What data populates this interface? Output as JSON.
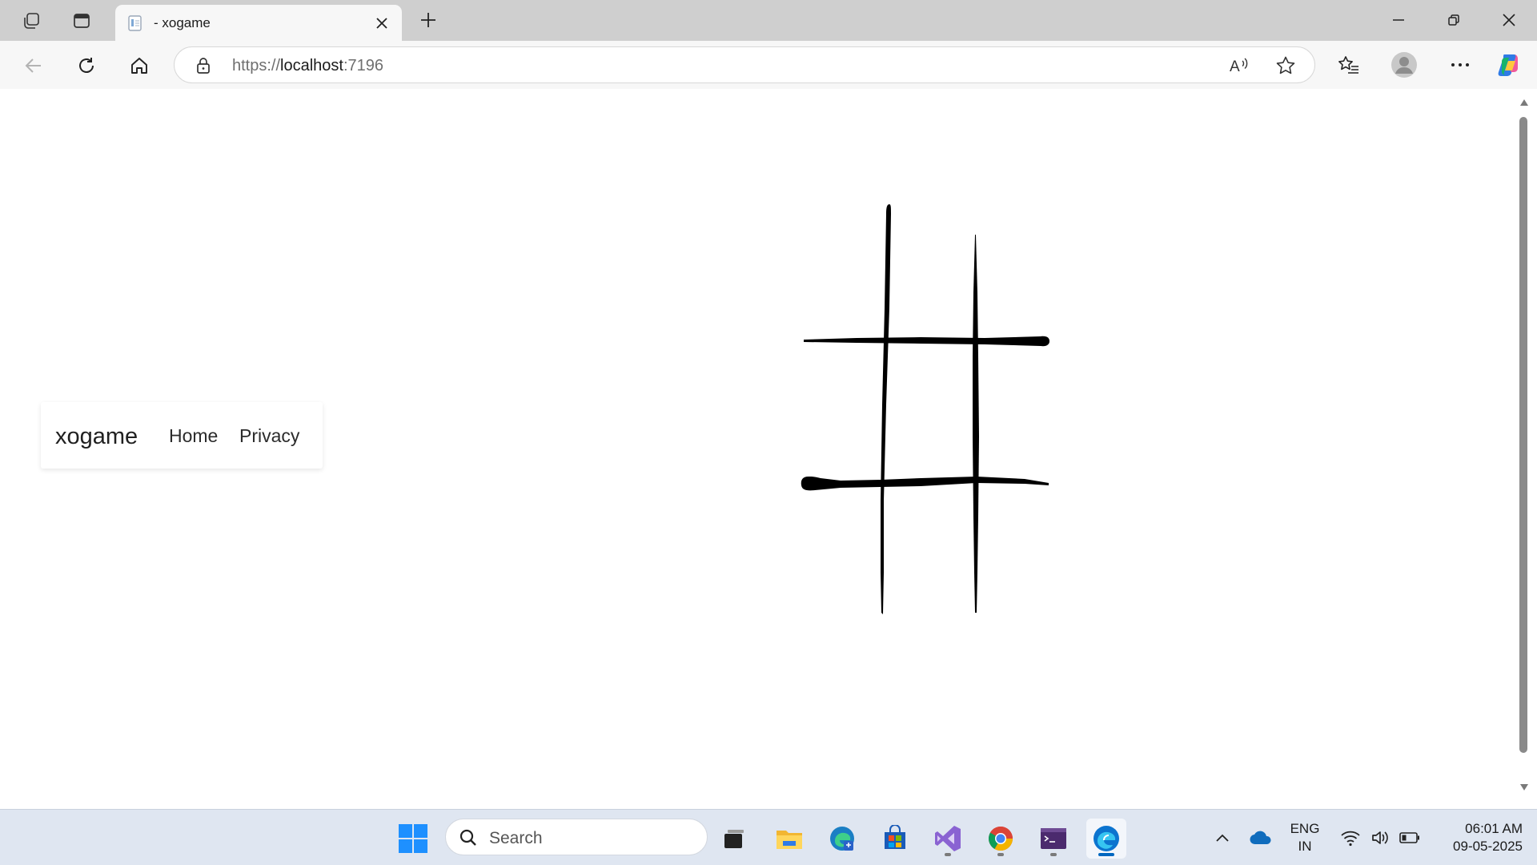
{
  "browser": {
    "tab": {
      "title": "- xogame",
      "close_glyph": "✕"
    },
    "new_tab_glyph": "+",
    "address": {
      "scheme": "https://",
      "host": "localhost",
      "port": ":7196"
    },
    "icons": [
      "workspaces-icon",
      "tab-actions-icon",
      "back-icon",
      "refresh-icon",
      "home-icon",
      "lock-icon",
      "read-aloud-icon",
      "favorite-star-icon",
      "favorites-icon",
      "profile-icon",
      "more-icon",
      "copilot-icon",
      "minimize-icon",
      "restore-icon",
      "close-window-icon"
    ]
  },
  "page": {
    "nav": {
      "brand": "xogame",
      "links": [
        {
          "label": "Home"
        },
        {
          "label": "Privacy"
        }
      ]
    },
    "board": {
      "image": "hand-drawn tic-tac-toe grid",
      "color": "#000000"
    }
  },
  "taskbar": {
    "search_placeholder": "Search",
    "apps": [
      "task-view",
      "file-explorer",
      "edge-dev",
      "microsoft-store",
      "visual-studio",
      "chrome",
      "terminal",
      "edge"
    ],
    "active_app": "edge",
    "language": {
      "line1": "ENG",
      "line2": "IN"
    },
    "clock": {
      "time": "06:01 AM",
      "date": "09-05-2025"
    }
  },
  "colors": {
    "accent": "#0067c0",
    "titlebar": "#cfcfcf",
    "toolbar": "#f7f7f7",
    "taskbar": "#dfe6f1"
  }
}
